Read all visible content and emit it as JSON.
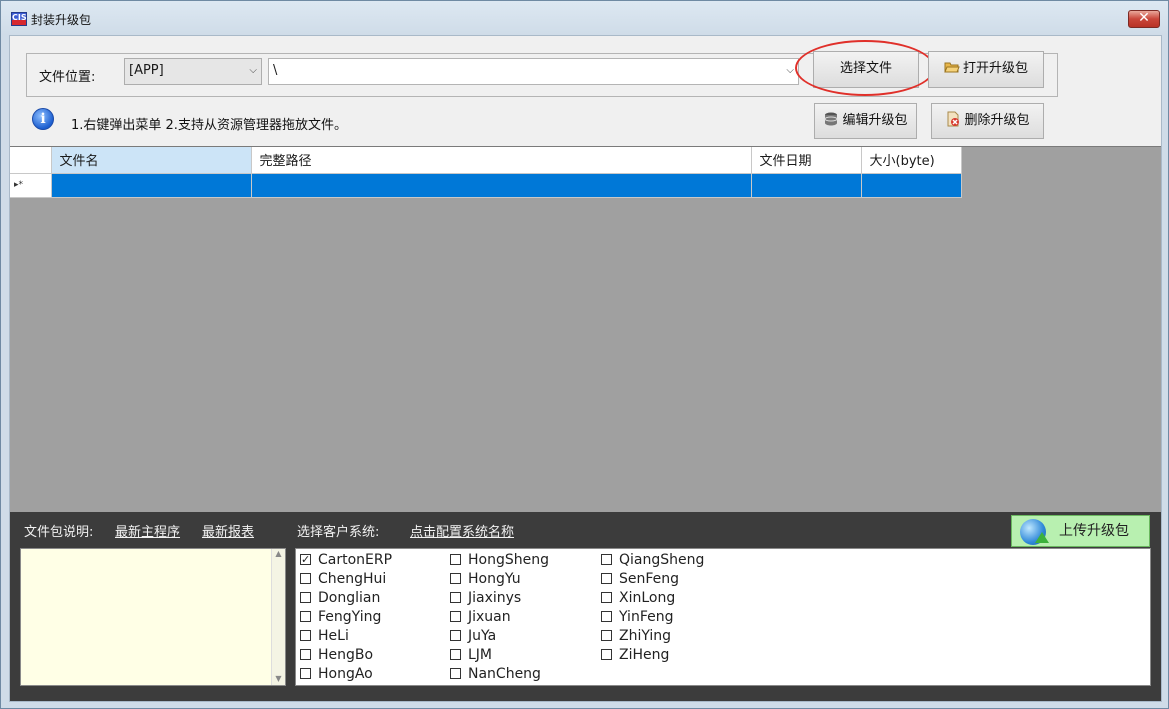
{
  "window": {
    "title": "封装升级包",
    "app_icon_text": "CIS",
    "close_glyph": "✕"
  },
  "location": {
    "label": "文件位置:",
    "root_value": "[APP]",
    "path_value": "\\"
  },
  "buttons": {
    "select_file": "选择文件",
    "open_package": "打开升级包",
    "edit_package": "编辑升级包",
    "delete_package": "删除升级包",
    "upload_package": "上传升级包"
  },
  "hint": {
    "icon": "info-icon",
    "text": "1.右键弹出菜单 2.支持从资源管理器拖放文件。"
  },
  "grid": {
    "columns": [
      "文件名",
      "完整路径",
      "文件日期",
      "大小(byte)"
    ],
    "row_marker": "▸*",
    "rows": [
      [
        "",
        "",
        "",
        ""
      ]
    ]
  },
  "bottom": {
    "package_desc_label": "文件包说明:",
    "link_latest_main": "最新主程序",
    "link_latest_report": "最新报表",
    "select_client_label": "选择客户系统:",
    "link_config_names": "点击配置系统名称",
    "clients": [
      {
        "name": "CartonERP",
        "checked": true
      },
      {
        "name": "ChengHui",
        "checked": false
      },
      {
        "name": "Donglian",
        "checked": false
      },
      {
        "name": "FengYing",
        "checked": false
      },
      {
        "name": "HeLi",
        "checked": false
      },
      {
        "name": "HengBo",
        "checked": false
      },
      {
        "name": "HongAo",
        "checked": false
      },
      {
        "name": "HongSheng",
        "checked": false
      },
      {
        "name": "HongYu",
        "checked": false
      },
      {
        "name": "Jiaxinys",
        "checked": false
      },
      {
        "name": "Jixuan",
        "checked": false
      },
      {
        "name": "JuYa",
        "checked": false
      },
      {
        "name": "LJM",
        "checked": false
      },
      {
        "name": "NanCheng",
        "checked": false
      },
      {
        "name": "QiangSheng",
        "checked": false
      },
      {
        "name": "SenFeng",
        "checked": false
      },
      {
        "name": "XinLong",
        "checked": false
      },
      {
        "name": "YinFeng",
        "checked": false
      },
      {
        "name": "ZhiYing",
        "checked": false
      },
      {
        "name": "ZiHeng",
        "checked": false
      }
    ]
  },
  "colors": {
    "selected_row": "#0078d7",
    "highlight_ellipse": "#e0302a",
    "upload_button": "#b8f0b0"
  }
}
